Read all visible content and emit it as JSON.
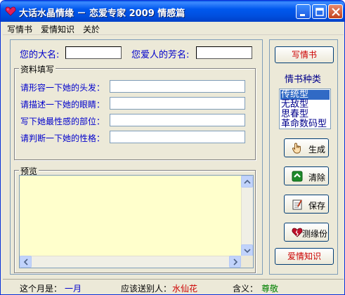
{
  "window": {
    "title": "大话水晶情缘 － 恋爱专家 2009 情感篇"
  },
  "menu": [
    "写情书",
    "爱情知识",
    "关於"
  ],
  "names": {
    "your_name_label": "您的大名:",
    "your_name_value": "",
    "lover_name_label": "您爱人的芳名:",
    "lover_name_value": ""
  },
  "profile": {
    "title": "资料填写",
    "fields": [
      {
        "label": "请形容一下她的头发：",
        "value": ""
      },
      {
        "label": "请描述一下她的眼睛：",
        "value": ""
      },
      {
        "label": "写下她最性感的部位：",
        "value": ""
      },
      {
        "label": "请判断一下她的性格：",
        "value": ""
      }
    ]
  },
  "preview": {
    "title": "预览",
    "content": ""
  },
  "side": {
    "write_letter": "写情书",
    "type_title": "情书种类",
    "types": [
      "传统型",
      "无敌型",
      "思春型",
      "革命数码型"
    ],
    "selected_type": "传统型",
    "generate": "生成",
    "clear": "清除",
    "save": "保存",
    "test": "测缘份",
    "love_knowledge": "爱情知识"
  },
  "status": {
    "month_label": "这个月是：",
    "month_value": "一月",
    "flower_label": "应该送别人：",
    "flower_value": "水仙花",
    "meaning_label": "含义：",
    "meaning_value": "尊敬"
  },
  "colors": {
    "titlebar": "#0054e3",
    "accent_blue": "#0000cc",
    "accent_red": "#cc0000",
    "preview_bg": "#ffffcc",
    "selection": "#316ac5"
  }
}
